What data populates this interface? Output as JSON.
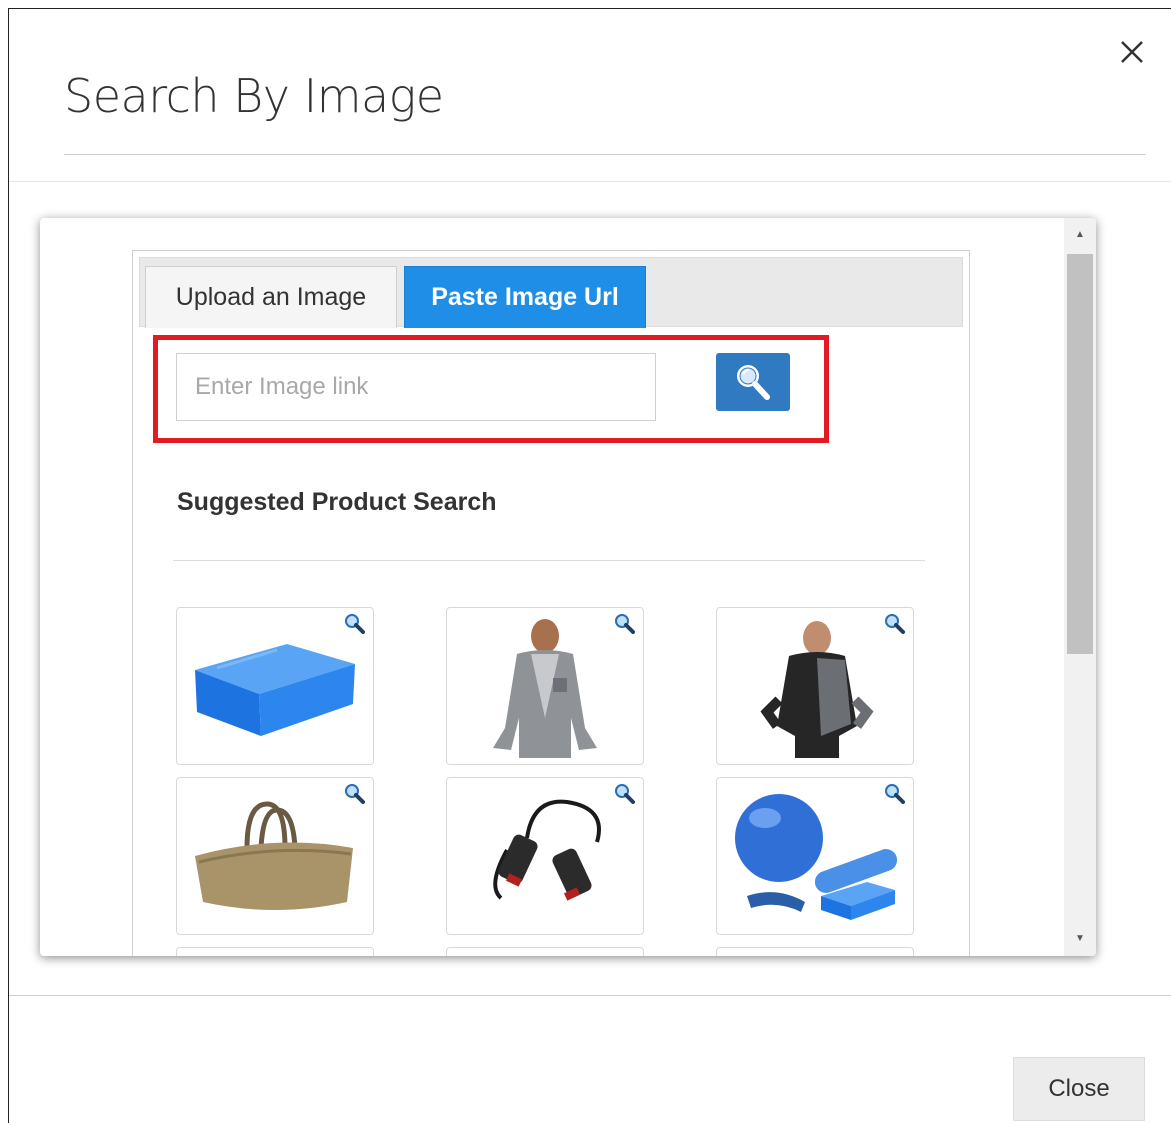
{
  "dialog": {
    "title": "Search By Image",
    "close_label": "Close"
  },
  "tabs": [
    {
      "label": "Upload an Image",
      "active": false
    },
    {
      "label": "Paste Image Url",
      "active": true
    }
  ],
  "url_search": {
    "placeholder": "Enter Image link",
    "value": ""
  },
  "suggested": {
    "title": "Suggested Product Search",
    "products": [
      {
        "name": "blue-foam-block",
        "icon": "zoom-icon"
      },
      {
        "name": "grey-hoodie-man",
        "icon": "zoom-icon"
      },
      {
        "name": "black-grey-jacket-man",
        "icon": "zoom-icon"
      },
      {
        "name": "tan-duffle-bag",
        "icon": "zoom-icon"
      },
      {
        "name": "resistance-band",
        "icon": "zoom-icon"
      },
      {
        "name": "yoga-ball-set",
        "icon": "zoom-icon"
      }
    ]
  },
  "colors": {
    "active_tab": "#1e8ee6",
    "search_button": "#2f7ac0",
    "highlight": "#e21a22"
  }
}
